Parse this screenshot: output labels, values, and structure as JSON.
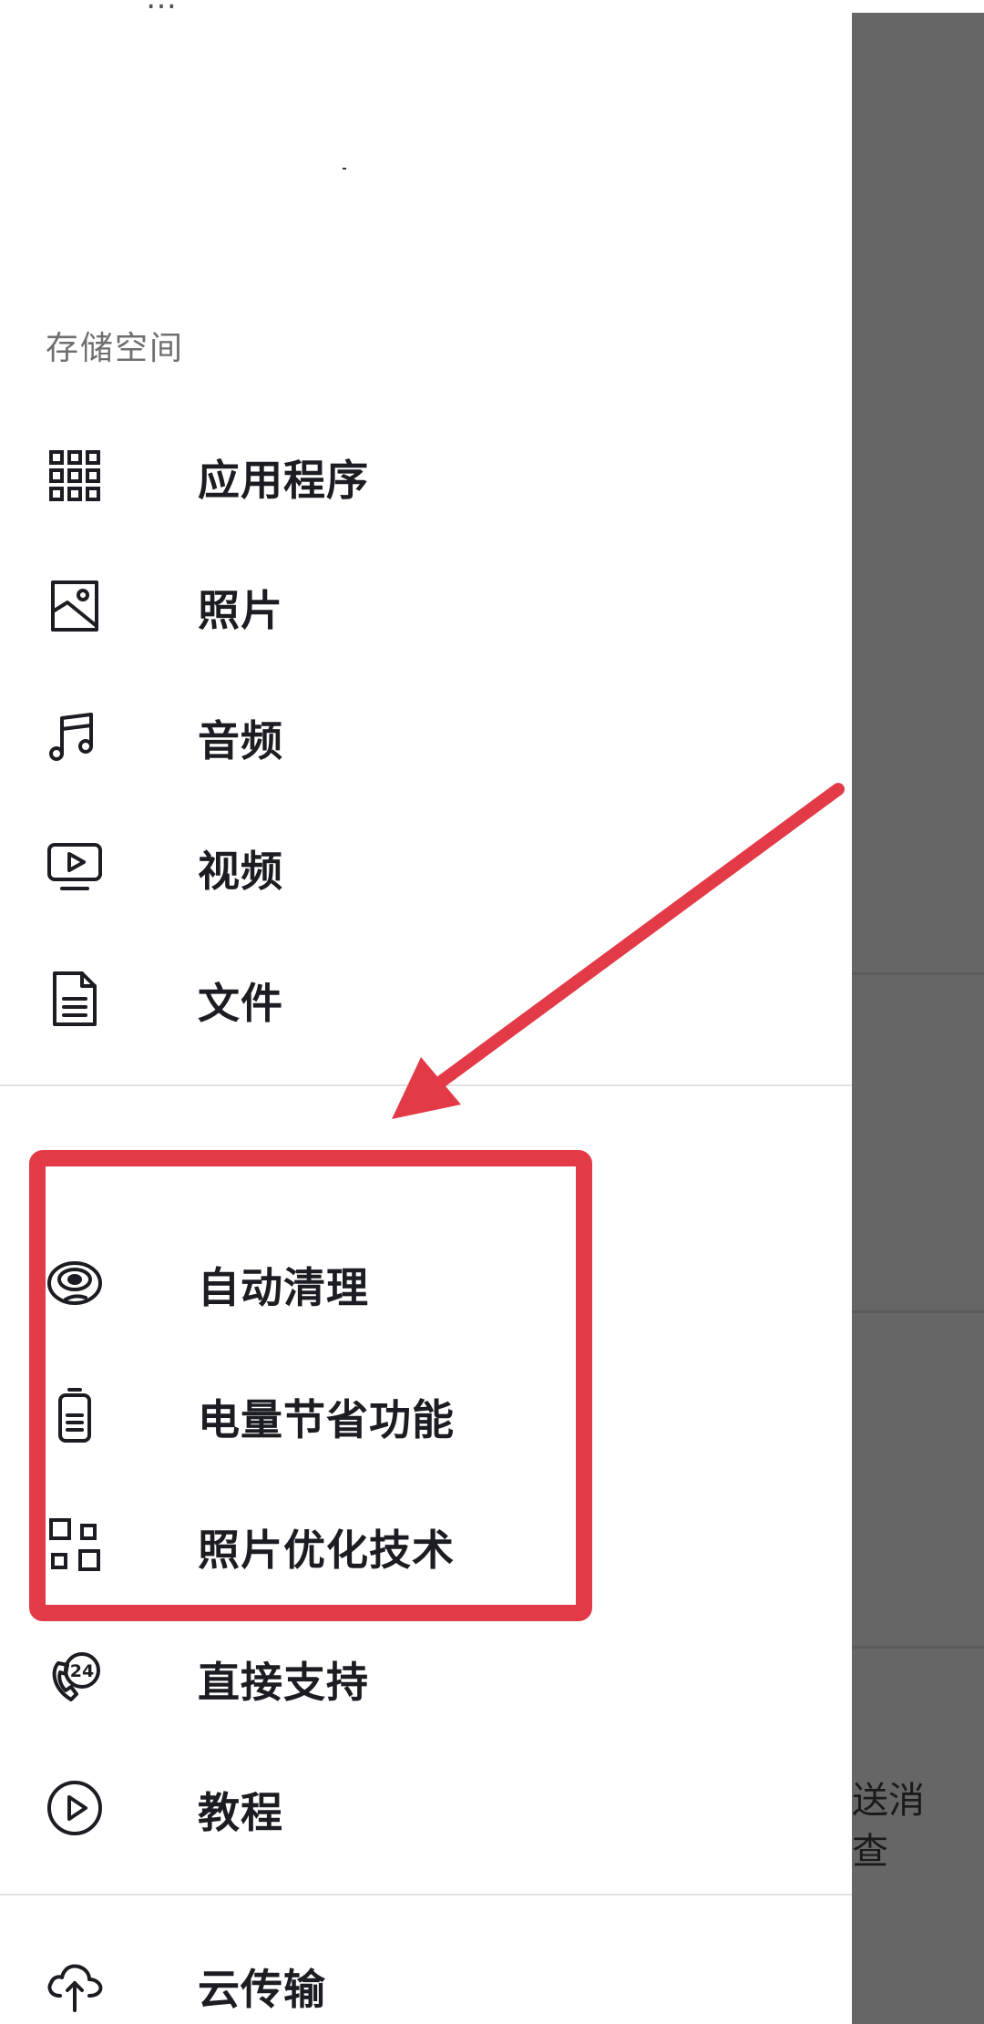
{
  "drawer": {
    "top_partial_text": "…",
    "storage_section_title": "存储空间",
    "storage_items": [
      {
        "label": "应用程序",
        "icon": "apps-grid-icon"
      },
      {
        "label": "照片",
        "icon": "photo-icon"
      },
      {
        "label": "音频",
        "icon": "music-note-icon"
      },
      {
        "label": "视频",
        "icon": "video-monitor-icon"
      },
      {
        "label": "文件",
        "icon": "document-icon"
      }
    ],
    "tool_items": [
      {
        "label": "自动清理",
        "icon": "auto-clean-icon"
      },
      {
        "label": "电量节省功能",
        "icon": "battery-icon"
      },
      {
        "label": "照片优化技术",
        "icon": "photo-optimize-icon"
      },
      {
        "label": "直接支持",
        "icon": "support-24h-icon"
      },
      {
        "label": "教程",
        "icon": "play-circle-icon"
      }
    ],
    "cloud_items": [
      {
        "label": "云传输",
        "icon": "cloud-upload-icon"
      }
    ]
  },
  "background": {
    "peek_line_1": "送消",
    "peek_line_2": "查"
  },
  "colors": {
    "annotation_red": "#e33a48",
    "scrim": "#666666",
    "text_primary": "#1b1d22",
    "text_secondary": "#6f6f6f"
  }
}
